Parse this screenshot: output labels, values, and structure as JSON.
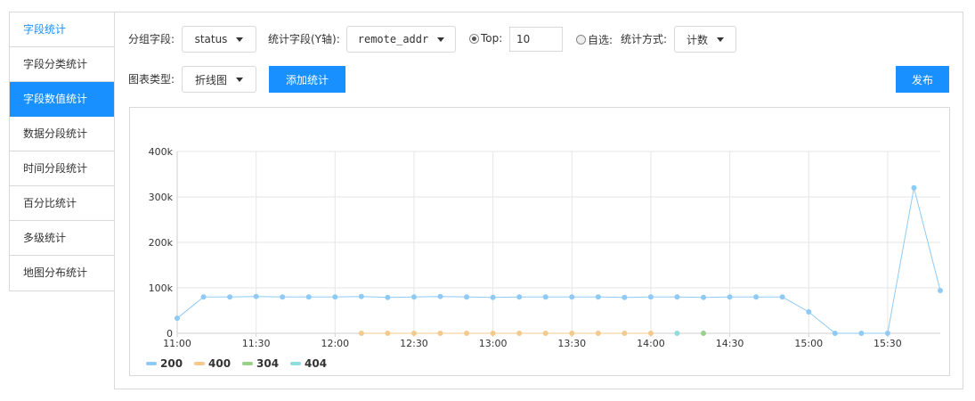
{
  "sidebar": {
    "items": [
      {
        "label": "字段统计",
        "state": "first"
      },
      {
        "label": "字段分类统计",
        "state": ""
      },
      {
        "label": "字段数值统计",
        "state": "active"
      },
      {
        "label": "数据分段统计",
        "state": ""
      },
      {
        "label": "时间分段统计",
        "state": ""
      },
      {
        "label": "百分比统计",
        "state": ""
      },
      {
        "label": "多级统计",
        "state": ""
      },
      {
        "label": "地图分布统计",
        "state": ""
      }
    ]
  },
  "toolbar": {
    "group_field_label": "分组字段:",
    "group_field_value": "status",
    "stat_field_label": "统计字段(Y轴):",
    "stat_field_value": "remote_addr",
    "top_label": "Top:",
    "top_value": "10",
    "custom_label": "自选:",
    "method_label": "统计方式:",
    "method_value": "计数",
    "chart_type_label": "图表类型:",
    "chart_type_value": "折线图",
    "add_button": "添加统计",
    "publish_button": "发布"
  },
  "colors": {
    "accent": "#1890ff",
    "s200": "#8fcaf5",
    "s400": "#f3c98c",
    "s304": "#9ad08a",
    "s404": "#8fdcdc"
  },
  "chart_data": {
    "type": "line",
    "x_ticks": [
      "11:00",
      "11:30",
      "12:00",
      "12:30",
      "13:00",
      "13:30",
      "14:00",
      "14:30",
      "15:00",
      "15:30"
    ],
    "y_ticks": [
      "0",
      "100k",
      "200k",
      "300k",
      "400k"
    ],
    "ylim": [
      0,
      400000
    ],
    "x_range_minutes": [
      0,
      290
    ],
    "grid": true,
    "legend_position": "bottom-left",
    "series": [
      {
        "name": "200",
        "color": "#8fcaf5",
        "x": [
          0,
          10,
          20,
          30,
          40,
          50,
          60,
          70,
          80,
          90,
          100,
          110,
          120,
          130,
          140,
          150,
          160,
          170,
          180,
          190,
          200,
          210,
          220,
          230,
          240,
          250,
          260,
          270,
          280,
          290
        ],
        "y": [
          33000,
          80000,
          80000,
          81000,
          80000,
          80000,
          80000,
          81000,
          79000,
          80000,
          81000,
          80000,
          79000,
          80000,
          80000,
          80000,
          80000,
          79000,
          80000,
          80000,
          79000,
          80000,
          80000,
          80000,
          47000,
          0,
          0,
          0,
          320000,
          94000
        ]
      },
      {
        "name": "400",
        "color": "#f3c98c",
        "x": [
          70,
          80,
          90,
          100,
          110,
          120,
          130,
          140,
          150,
          160,
          170,
          180
        ],
        "y": [
          0,
          0,
          0,
          0,
          0,
          0,
          0,
          0,
          0,
          0,
          0,
          0
        ]
      },
      {
        "name": "304",
        "color": "#9ad08a",
        "x": [
          200
        ],
        "y": [
          0
        ]
      },
      {
        "name": "404",
        "color": "#8fdcdc",
        "x": [
          190
        ],
        "y": [
          0
        ]
      }
    ]
  }
}
